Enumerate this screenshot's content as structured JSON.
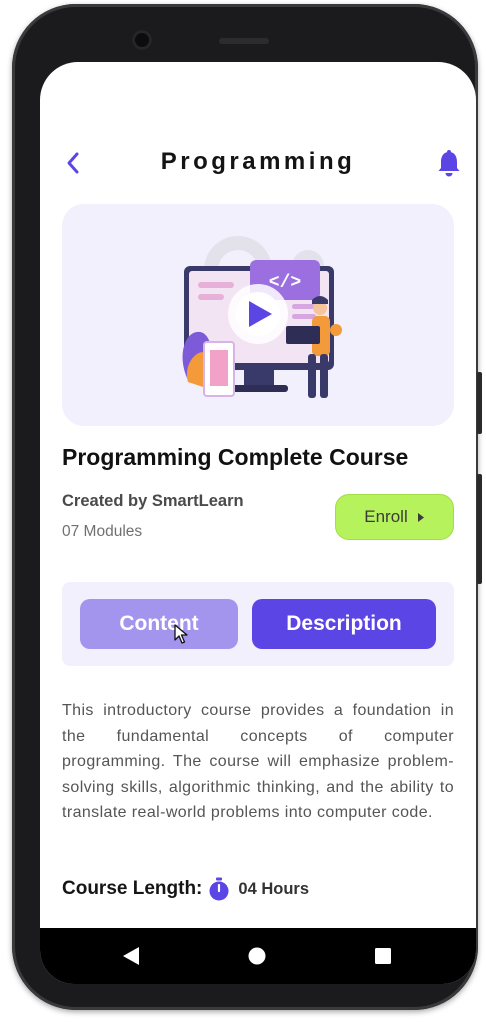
{
  "header": {
    "title": "Programming",
    "back_icon": "chevron-left-icon",
    "notification_icon": "bell-icon"
  },
  "hero": {
    "illustration": "programming-course-illustration",
    "code_tag": "</>"
  },
  "course": {
    "title": "Programming Complete Course",
    "creator": "Created by SmartLearn",
    "modules": "07 Modules",
    "enroll_label": "Enroll"
  },
  "tabs": [
    {
      "label": "Content"
    },
    {
      "label": "Description"
    }
  ],
  "description": "This introductory course provides a foundation in the fundamental concepts of computer programming. The course will emphasize problem-solving skills, algorithmic thinking, and the ability to translate real-world problems into computer code.",
  "course_length": {
    "label": "Course Length:",
    "value": "04 Hours",
    "icon": "timer-icon"
  },
  "navbar": {
    "items": [
      "back-triangle-icon",
      "home-circle-icon",
      "recents-square-icon"
    ]
  },
  "colors": {
    "primary": "#5b45e5",
    "primary_light": "#a394ee",
    "accent_green": "#b6f25b",
    "panel_bg": "#f1f0fc"
  }
}
